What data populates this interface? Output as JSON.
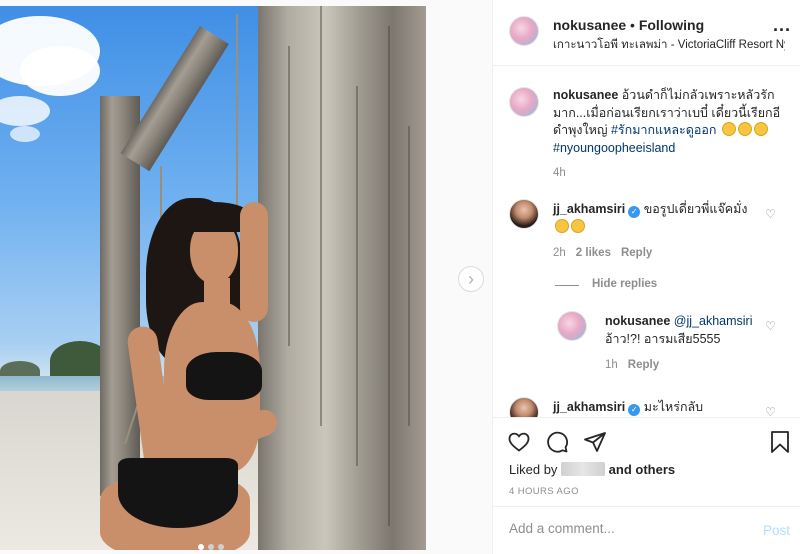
{
  "post": {
    "username": "nokusanee",
    "dot": "•",
    "follow_status": "Following",
    "location": "เกาะนาวโอพี ทะเลพม่า - VictoriaCliff Resort Ny...",
    "more_icon": "more-horizontal-icon",
    "photo_dots": 3,
    "photo_active_index": 0
  },
  "caption": {
    "username": "nokusanee",
    "line1": "อ้วนดำก็ไม่กลัวเพราะหลัวรัก",
    "line2": "มาก...เมื่อก่อนเรียกเราว่าเบบี๋ เดี๋ยวนี้เรียกอี",
    "line3": "ดำพุงใหญ่",
    "hashtag1": "#รักมากแหละดูออก",
    "hashtag2": "#nyoungoopheeisland",
    "time": "4h"
  },
  "comments": [
    {
      "username": "jj_akhamsiri",
      "text": "ขอรูปเดี่ยวพี่แจ๊คมั่ง",
      "time": "2h",
      "likes": "2 likes",
      "reply": "Reply"
    },
    {
      "username": "nokusanee",
      "mention": "@jj_akhamsiri",
      "text": "อ้าว!?! อารมเสีย5555",
      "time": "1h",
      "reply": "Reply"
    },
    {
      "username": "jj_akhamsiri",
      "text": "มะไหร่กลับ"
    }
  ],
  "hide_replies": "Hide replies",
  "actions": {
    "liked_by_prefix": "Liked by",
    "and_others": "and others",
    "time_ago": "4 HOURS AGO"
  },
  "add_comment": {
    "placeholder": "Add a comment...",
    "post_label": "Post"
  },
  "colors": {
    "link": "#00376b",
    "verified": "#3897f0",
    "muted": "#8e8e8e",
    "post_disabled": "#b2dffc"
  }
}
